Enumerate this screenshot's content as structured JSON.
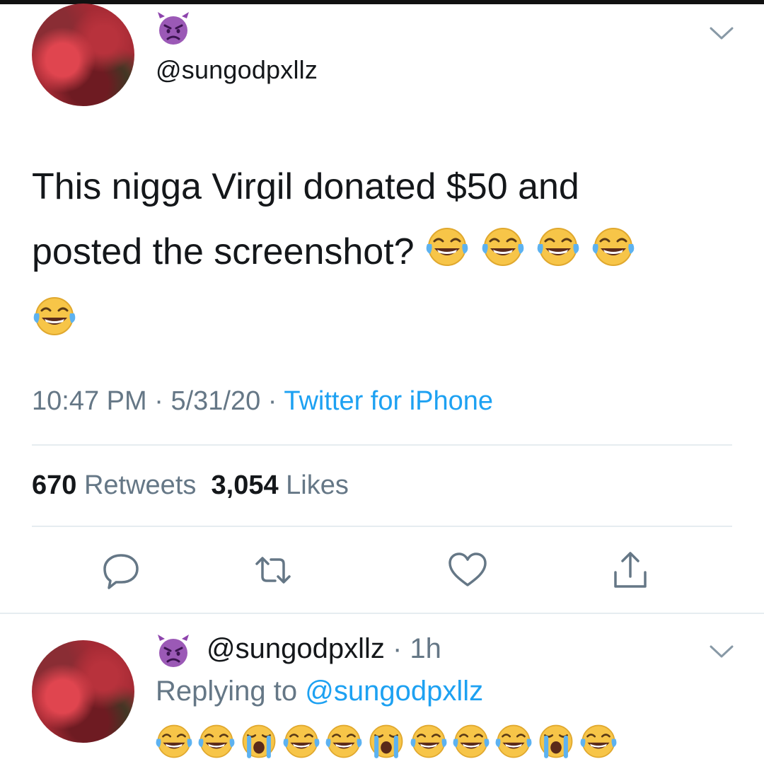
{
  "tweet": {
    "handle": "@sungodpxllz",
    "text_line1": "This nigga Virgil donated $50 and",
    "text_line2": "posted the screenshot?",
    "time": "10:47 PM",
    "date": "5/31/20",
    "source": "Twitter for iPhone",
    "retweet_count": "670",
    "retweet_label": "Retweets",
    "like_count": "3,054",
    "like_label": "Likes",
    "emojis": [
      "face-with-tears-of-joy",
      "face-with-tears-of-joy",
      "face-with-tears-of-joy",
      "face-with-tears-of-joy",
      "face-with-tears-of-joy"
    ]
  },
  "reply": {
    "handle": "@sungodpxllz",
    "time": "1h",
    "replying_prefix": "Replying to",
    "replying_to": "@sungodpxllz",
    "emojis": [
      "face-with-tears-of-joy",
      "face-with-tears-of-joy",
      "loudly-crying-face",
      "face-with-tears-of-joy",
      "face-with-tears-of-joy",
      "loudly-crying-face",
      "face-with-tears-of-joy",
      "face-with-tears-of-joy",
      "face-with-tears-of-joy",
      "loudly-crying-face",
      "face-with-tears-of-joy"
    ]
  },
  "icons": {
    "name_badge": "angry-devil-emoji",
    "more": "chevron-down-icon",
    "actions": [
      "reply-icon",
      "retweet-icon",
      "like-heart-icon",
      "share-icon"
    ]
  },
  "colors": {
    "link": "#1da1f2",
    "secondary_text": "#657786",
    "primary_text": "#14171a",
    "divider": "#e6ecf0"
  }
}
